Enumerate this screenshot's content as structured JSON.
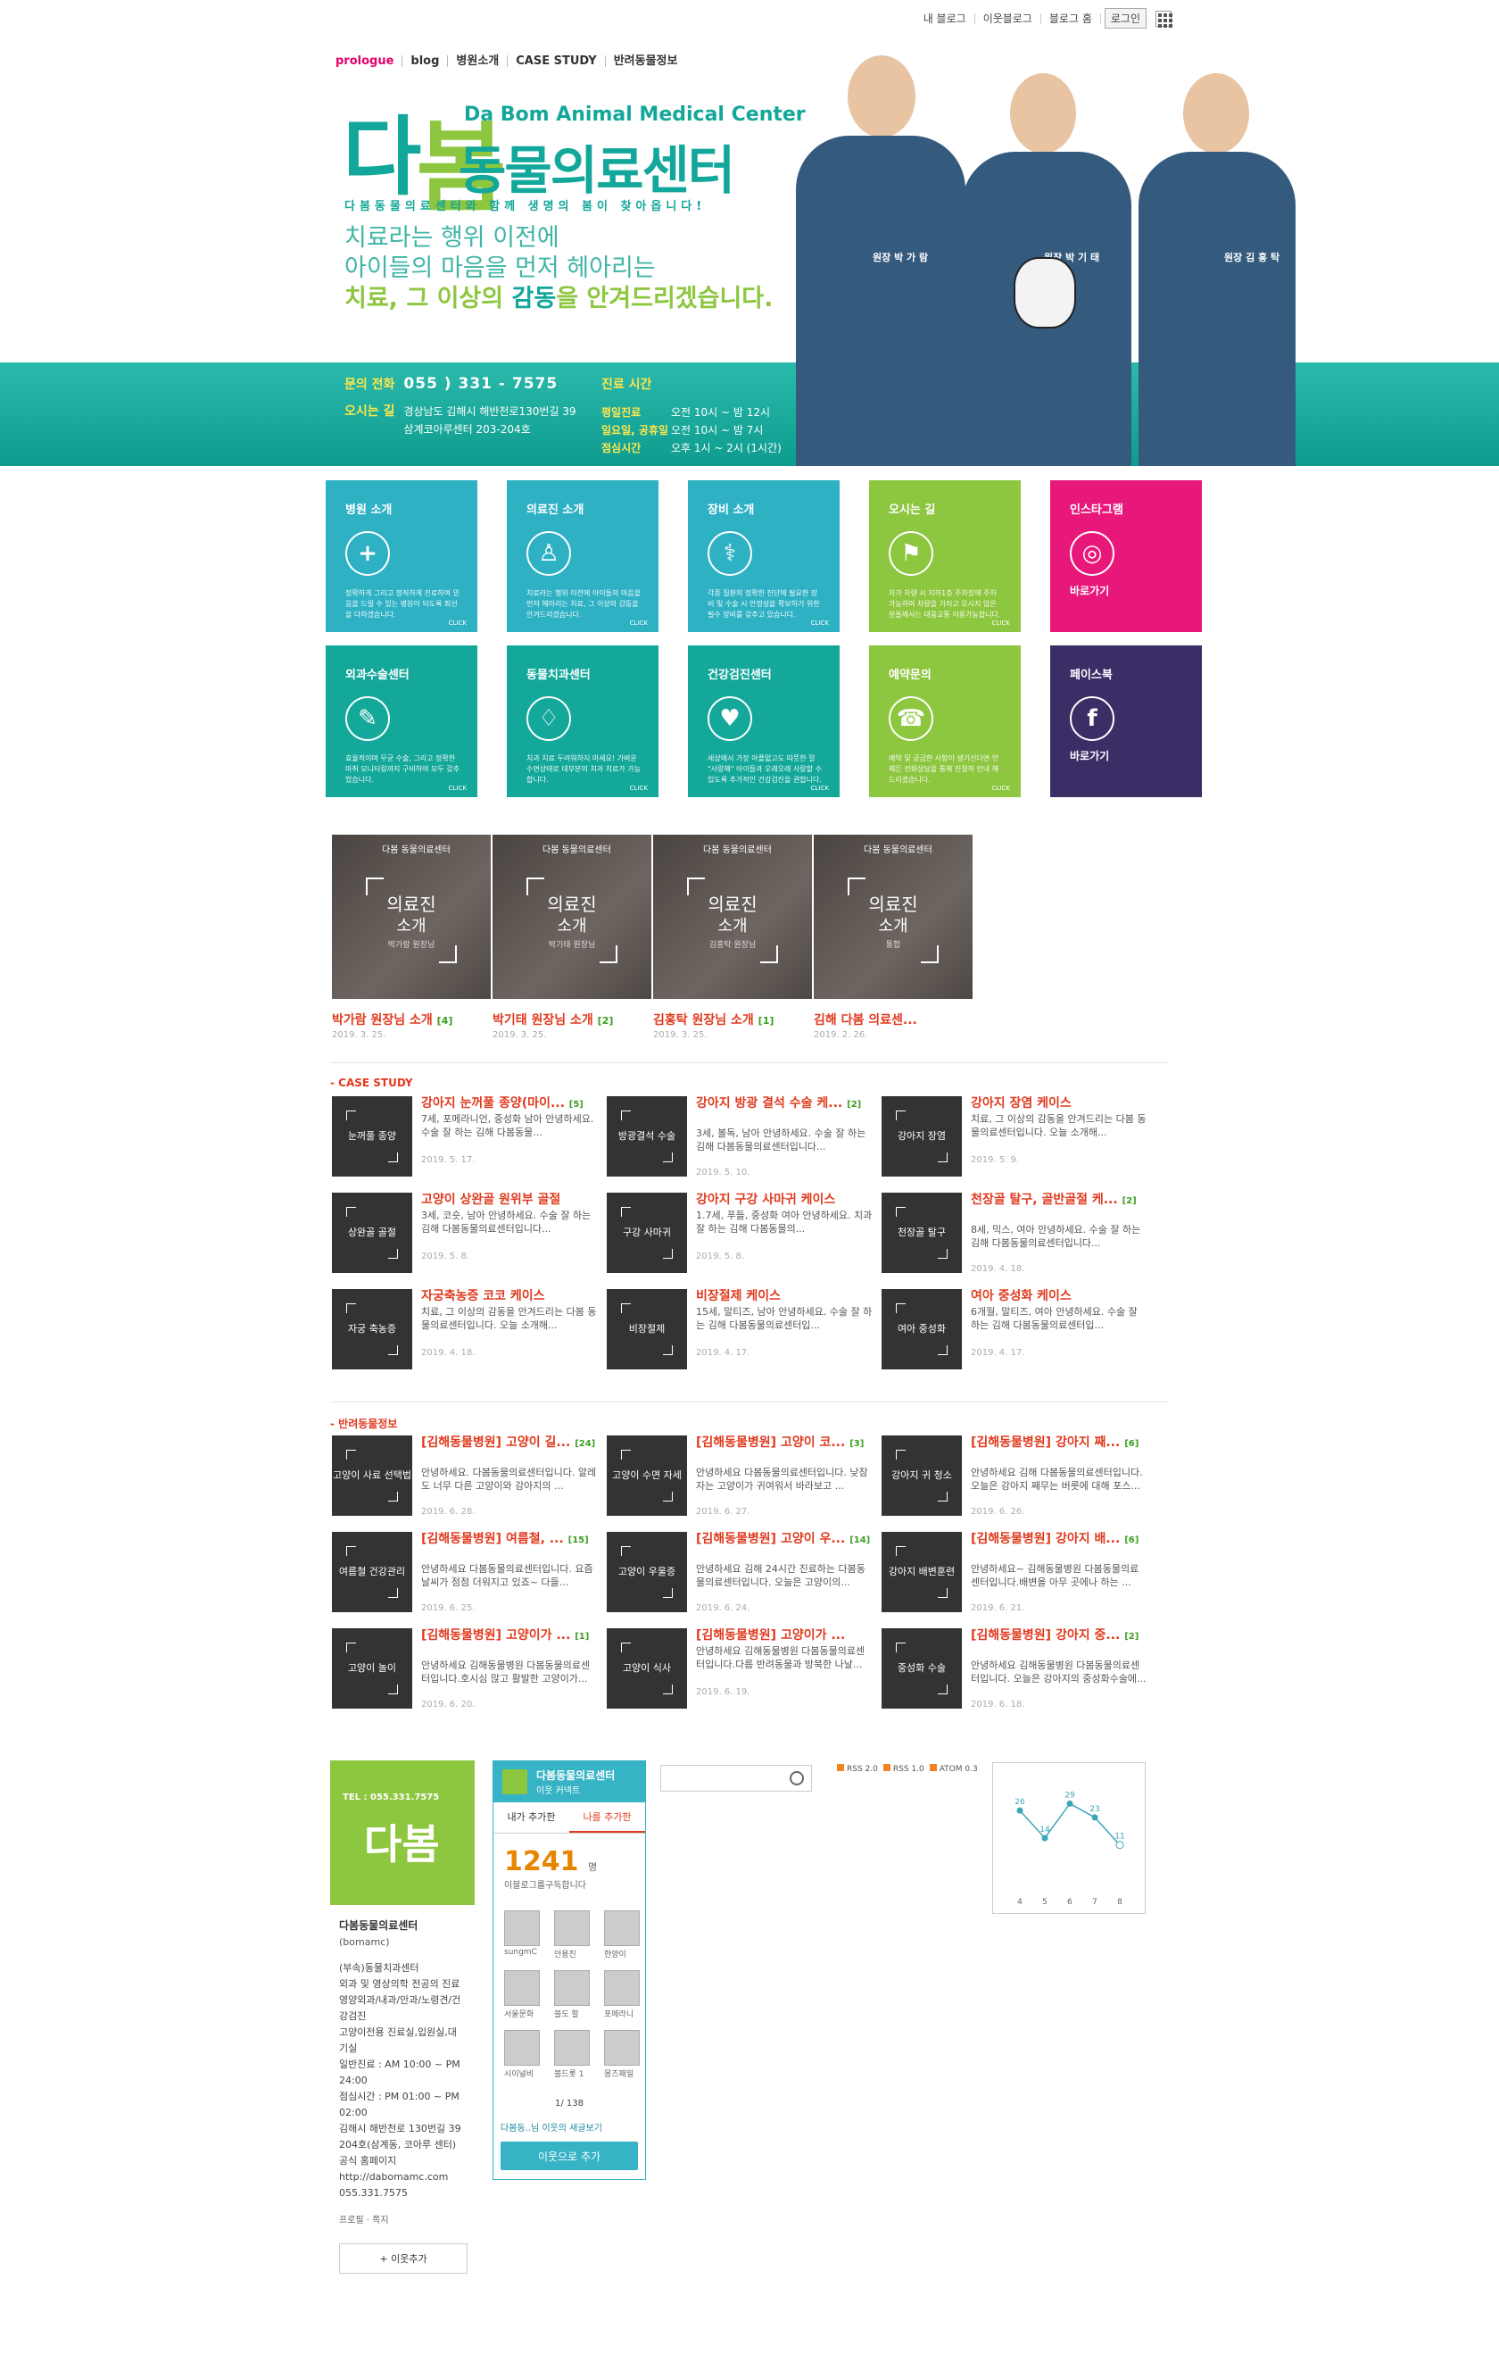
{
  "topbar": {
    "links": [
      "내 블로그",
      "이웃블로그",
      "블로그 홈"
    ],
    "login": "로그인"
  },
  "nav": [
    "prologue",
    "blog",
    "병원소개",
    "CASE STUDY",
    "반려동물정보"
  ],
  "logo": {
    "mark_a": "다",
    "mark_b": "봄",
    "en": "Da Bom Animal Medical Center",
    "ko": "동물의료센터",
    "sub": "다봄동물의료센터와 함께 생명의 봄이 찾아옵니다!"
  },
  "slogan": {
    "l1": "치료라는 행위 이전에",
    "l2": "아이들의 마음을 먼저 헤아리는",
    "l3a": "치료, 그 이상의 ",
    "l3b": "감동",
    "l3c": "을 안겨드리겠습니다."
  },
  "contact": {
    "phone_label": "문의 전화",
    "phone": "055 ) 331 - 7575",
    "addr_label": "오시는 길",
    "addr1": "경상남도 김해시 해반천로130번길 39",
    "addr2": "삼계코아루센터 203-204호"
  },
  "hours": {
    "label": "진료 시간",
    "rows": [
      {
        "d": "평일진료",
        "t": "오전 10시 ~ 밤 12시"
      },
      {
        "d": "일요일, 공휴일",
        "t": "오전 10시 ~ 밤 7시"
      },
      {
        "d": "점심시간",
        "t": "오후 1시 ~ 2시 (1시간)"
      }
    ]
  },
  "doctors": [
    "원장 박 가 람",
    "원장 박 기 태",
    "원장 김 홍 탁"
  ],
  "tiles": [
    {
      "t": "병원 소개",
      "d": "정확하게 그리고 정직하게 진료하여 믿음을 드릴 수 있는 병원이 되도록 최선을 다하겠습니다.",
      "icon": "plus-icon",
      "g": "+",
      "c": "#2fb1c4"
    },
    {
      "t": "의료진 소개",
      "d": "치료라는 행위 이전에 아이들의 마음을 먼저 헤아리는 치료, 그 이상의 감동을 안겨드리겠습니다.",
      "icon": "doctor-icon",
      "g": "♙",
      "c": "#2fb1c4"
    },
    {
      "t": "장비 소개",
      "d": "각종 질환의 정확한 진단에 필요한 장비 및 수술 시 안정성을 확보하기 위한 필수 장비를 갖추고 있습니다.",
      "icon": "stethoscope-icon",
      "g": "⚕",
      "c": "#2fb1c4"
    },
    {
      "t": "오시는 길",
      "d": "자가 차량 시 지하1층 주차장에 주차 가능하며 차량을 가지고 오시지 않은 분들께서는 대중교통 이용가능합니다.",
      "icon": "map-icon",
      "g": "⚑",
      "c": "#8dc63f"
    },
    {
      "t": "인스타그램",
      "go": "바로가기",
      "icon": "instagram-icon",
      "g": "◎",
      "c": "#e8187a"
    },
    {
      "t": "외과수술센터",
      "d": "효율적이며 무균 수술, 그리고 정확한 마취 모니터링까지 구비하여 모두 갖추었습니다.",
      "icon": "scalpel-icon",
      "g": "✎",
      "c": "#14a89b"
    },
    {
      "t": "동물치과센터",
      "d": "치과 치료 두려워하지 마세요! 가벼운 수면상태로 대부분의 치과 치료가 가능합니다.",
      "icon": "tooth-icon",
      "g": "♢",
      "c": "#14a89b"
    },
    {
      "t": "건강검진센터",
      "d": "세상에서 가장 아플없고도 따뜻한 말 \"사랑해\" 아이들과 오래오래 사랑할 수 있도록 추가적인 건강검진을 권합니다.",
      "icon": "heart-pulse-icon",
      "g": "♥",
      "c": "#14a89b"
    },
    {
      "t": "예약문의",
      "d": "예약 및 궁금한 사항이 생기신다면 언제든 전화상담을 통해 친절히 안내 해드리겠습니다.",
      "icon": "phone-icon",
      "g": "☎",
      "c": "#8dc63f"
    },
    {
      "t": "페이스북",
      "go": "바로가기",
      "icon": "facebook-icon",
      "g": "f",
      "c": "#3b2d66"
    }
  ],
  "tile_click": "CLICK",
  "staff": [
    {
      "m1": "의료진",
      "m2": "소개",
      "m3": "박가람 원장님",
      "title": "박가람 원장님 소개",
      "cnt": "[4]",
      "date": "2019. 3. 25."
    },
    {
      "m1": "의료진",
      "m2": "소개",
      "m3": "박기태 원장님",
      "title": "박기태 원장님 소개",
      "cnt": "[2]",
      "date": "2019. 3. 25."
    },
    {
      "m1": "의료진",
      "m2": "소개",
      "m3": "김홍탁 원장님",
      "title": "김홍탁 원장님 소개",
      "cnt": "[1]",
      "date": "2019. 3. 25."
    },
    {
      "m1": "의료진",
      "m2": "소개",
      "m3": "통합",
      "title": "김해 다봄 의료센...",
      "cnt": "",
      "date": "2019. 2. 26."
    }
  ],
  "staff_brand": "다봄 동물의료센터",
  "case": {
    "label": "- CASE STUDY",
    "posts": [
      {
        "th": "눈꺼풀 종양",
        "title": "강아지 눈꺼풀 종양(마이...",
        "cnt": "[5]",
        "ex": "7세, 포메라니언, 중성화 남아 안녕하세요. 수술 잘 하는 김해 다봄동물...",
        "date": "2019. 5. 17."
      },
      {
        "th": "방광결석 수술",
        "title": "강아지 방광 결석 수술 케...",
        "cnt": "[2]",
        "ex": "3세, 볼독, 남아 안녕하세요. 수술 잘 하는 김해 다봄동물의료센터입니다...",
        "date": "2019. 5. 10."
      },
      {
        "th": "강아지 장염",
        "title": "강아지 장염 케이스",
        "cnt": "",
        "ex": "치료, 그 이상의 감동을 안겨드리는 다봄 동물의료센터입니다. 오늘 소개해...",
        "date": "2019. 5. 9."
      },
      {
        "th": "상완골 골절",
        "title": "고양이 상완골 원위부 골절",
        "cnt": "",
        "ex": "3세, 코숏, 남아 안녕하세요. 수술 잘 하는 김해 다봄동물의료센터입니다...",
        "date": "2019. 5. 8."
      },
      {
        "th": "구강 사마귀",
        "title": "강아지 구강 사마귀 케이스",
        "cnt": "",
        "ex": "1.7세, 푸들, 중성화 여아 안녕하세요. 치과 잘 하는 김해 다봄동물의...",
        "date": "2019. 5. 8."
      },
      {
        "th": "천장골 탈구",
        "title": "천장골 탈구, 골반골절 케...",
        "cnt": "[2]",
        "ex": "8세, 믹스, 여아 안녕하세요. 수술 잘 하는 김해 다봄동물의료센터입니다...",
        "date": "2019. 4. 18."
      },
      {
        "th": "자궁 축농증",
        "title": "자궁축농증 코코 케이스",
        "cnt": "",
        "ex": "치료, 그 이상의 감동을 안겨드리는 다봄 동물의료센터입니다. 오늘 소개해...",
        "date": "2019. 4. 18."
      },
      {
        "th": "비장절제",
        "title": "비장절제 케이스",
        "cnt": "",
        "ex": "15세, 말티즈, 남아 안녕하세요. 수술 잘 하는 김해 다봄동물의료센터입...",
        "date": "2019. 4. 17."
      },
      {
        "th": "여아 중성화",
        "title": "여아 중성화 케이스",
        "cnt": "",
        "ex": "6개월, 말티즈, 여아 안녕하세요. 수술 잘 하는 김해 다봄동물의료센터입...",
        "date": "2019. 4. 17."
      }
    ]
  },
  "pet": {
    "label": "- 반려동물정보",
    "posts": [
      {
        "th": "고양이 사료 선택법",
        "title": "[김해동물병원] 고양이 길...",
        "cnt": "[24]",
        "ex": "안녕하세요. 다봄동물의료센터입니다. 알레도 너무 다른 고양이와 강아지의 ...",
        "date": "2019. 6. 28."
      },
      {
        "th": "고양이 수면 자세",
        "title": "[김해동물병원] 고양이 코...",
        "cnt": "[3]",
        "ex": "안녕하세요 다봄동물의료센터입니다. 낮잠 자는 고양이가 귀여워서 바라보고 ...",
        "date": "2019. 6. 27."
      },
      {
        "th": "강아지 귀 청소",
        "title": "[김해동물병원] 강아지 째...",
        "cnt": "[6]",
        "ex": "안녕하세요 김해 다봄동물의료센터입니다. 오늘은 강아지 째무는 버릇에 대해 포스...",
        "date": "2019. 6. 26."
      },
      {
        "th": "여름철 건강관리",
        "title": "[김해동물병원] 여름철, ...",
        "cnt": "[15]",
        "ex": "안녕하세요 다봄동물의료센터입니다. 요즘 날씨가 점점 더워지고 있죠~ 다들...",
        "date": "2019. 6. 25."
      },
      {
        "th": "고양이 우울증",
        "title": "[김해동물병원] 고양이 우...",
        "cnt": "[14]",
        "ex": "안녕하세요 김해 24시간 진료하는 다봄동물의료센터입니다. 오늘은 고양이의...",
        "date": "2019. 6. 24."
      },
      {
        "th": "강아지 배변훈련",
        "title": "[김해동물병원] 강아지 배...",
        "cnt": "[6]",
        "ex": "안녕하세요~ 김해동물병원 다봄동물의료센터입니다.배변을 아무 곳에나 하는 ...",
        "date": "2019. 6. 21."
      },
      {
        "th": "고양이 놀이",
        "title": "[김해동물병원] 고양이가 ...",
        "cnt": "[1]",
        "ex": "안녕하세요 김해동물병원 다봄동물의료센터입니다.호시심 많고 활발한 고양이가...",
        "date": "2019. 6. 20."
      },
      {
        "th": "고양이 식사",
        "title": "[김해동물병원] 고양이가 ...",
        "cnt": "",
        "ex": "안녕하세요 김해동물병원 다봄동물의료센터입니다.다름 반려동물과 방북한 나날...",
        "date": "2019. 6. 19."
      },
      {
        "th": "중성화 수술",
        "title": "[김해동물병원] 강아지 중...",
        "cnt": "[2]",
        "ex": "안녕하세요 김해동물병원 다봄동물의료센터입니다. 오늘은 강아지의 중성화수술에...",
        "date": "2019. 6. 18."
      }
    ]
  },
  "profile": {
    "tel": "TEL : 055.331.7575",
    "mark": "다봄",
    "name": "다봄동물의료센터",
    "id": "(bomamc)",
    "info": [
      "(부속)동물치과센터",
      "외과 및 영상의학 전공의 진료",
      "영양외과/내과/안과/노령견/건강검진",
      "고양이전용 진료실,입원실,대기실",
      "일반진료 : AM 10:00 ~ PM 24:00",
      "점심시간 : PM 01:00 ~ PM 02:00",
      "김해시 해반천로 130번길 39 204호(삼계동, 코아루 센터)",
      "공식 홈페이지 http://dabomamc.com",
      "055.331.7575"
    ],
    "prof": "프로필 · 쪽지",
    "add": "+ 이웃추가"
  },
  "neighbor": {
    "title": "다봄동물의료센터",
    "sub": "이웃 커넥트",
    "tabs": [
      "내가 추가한",
      "나를 추가한"
    ],
    "count": "1241",
    "count_unit": "명",
    "count_sub": "이블로그를구독합니다",
    "avatars": [
      "sungmC",
      "안용진",
      "한양이",
      "서울문화",
      "블도 할",
      "포메라니",
      "시이널비",
      "블드롯 1",
      "몽즈패밀"
    ],
    "page": "1/ 138",
    "recent": "다봄동..님 이웃의 새글보기",
    "button": "이웃으로 추가"
  },
  "rss": [
    "RSS 2.0",
    "RSS 1.0",
    "ATOM 0.3"
  ],
  "chart_data": {
    "type": "line",
    "categories": [
      "4",
      "5",
      "6",
      "7",
      "8"
    ],
    "values": [
      26,
      14,
      29,
      23,
      11
    ]
  }
}
